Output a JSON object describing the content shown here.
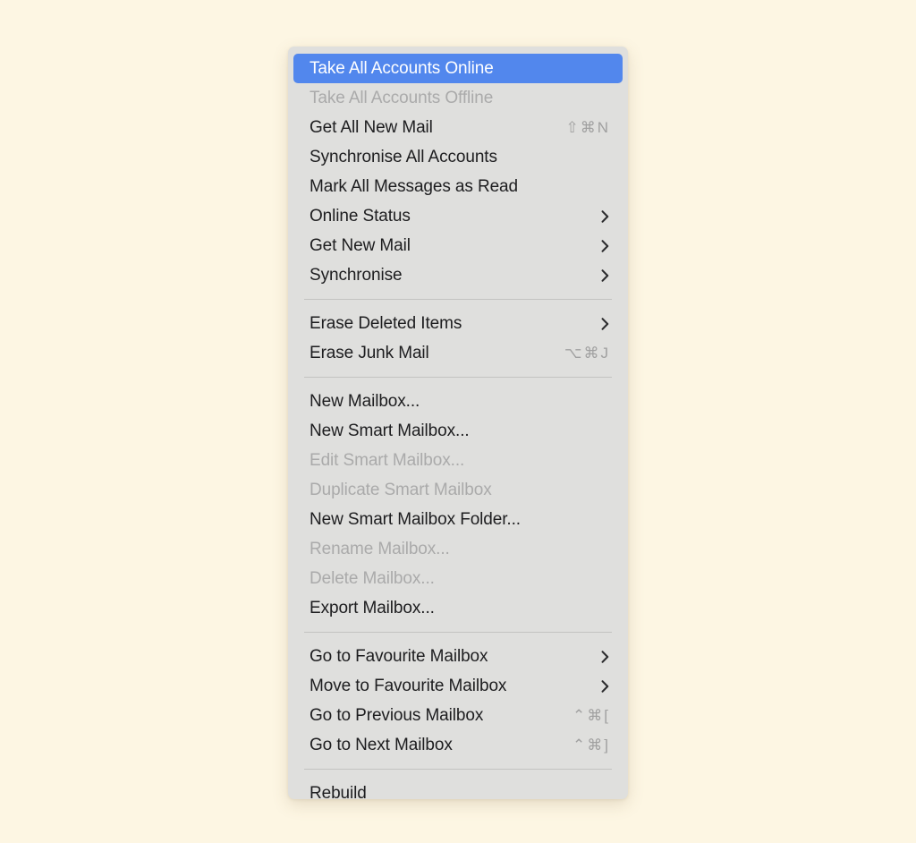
{
  "window": {
    "title": "Mailbox Menu",
    "background_color": "#fdf6e3",
    "panel_color": "#dfdfdd",
    "highlight_color": "#5287ed",
    "text_color": "#1d1d1f",
    "disabled_text_color": "#aaaaaa",
    "separator_color": "#c3c3c1"
  },
  "menu": {
    "groups": [
      {
        "items": [
          {
            "label": "Take All Accounts Online",
            "shortcut": "",
            "submenu": false,
            "disabled": false,
            "selected": true
          },
          {
            "label": "Take All Accounts Offline",
            "shortcut": "",
            "submenu": false,
            "disabled": true,
            "selected": false
          },
          {
            "label": "Get All New Mail",
            "shortcut": "⇧⌘N",
            "submenu": false,
            "disabled": false,
            "selected": false
          },
          {
            "label": "Synchronise All Accounts",
            "shortcut": "",
            "submenu": false,
            "disabled": false,
            "selected": false
          },
          {
            "label": "Mark All Messages as Read",
            "shortcut": "",
            "submenu": false,
            "disabled": false,
            "selected": false
          },
          {
            "label": "Online Status",
            "shortcut": "",
            "submenu": true,
            "disabled": false,
            "selected": false
          },
          {
            "label": "Get New Mail",
            "shortcut": "",
            "submenu": true,
            "disabled": false,
            "selected": false
          },
          {
            "label": "Synchronise",
            "shortcut": "",
            "submenu": true,
            "disabled": false,
            "selected": false
          }
        ]
      },
      {
        "items": [
          {
            "label": "Erase Deleted Items",
            "shortcut": "",
            "submenu": true,
            "disabled": false,
            "selected": false
          },
          {
            "label": "Erase Junk Mail",
            "shortcut": "⌥⌘J",
            "submenu": false,
            "disabled": false,
            "selected": false
          }
        ]
      },
      {
        "items": [
          {
            "label": "New Mailbox...",
            "shortcut": "",
            "submenu": false,
            "disabled": false,
            "selected": false
          },
          {
            "label": "New Smart Mailbox...",
            "shortcut": "",
            "submenu": false,
            "disabled": false,
            "selected": false
          },
          {
            "label": "Edit Smart Mailbox...",
            "shortcut": "",
            "submenu": false,
            "disabled": true,
            "selected": false
          },
          {
            "label": "Duplicate Smart Mailbox",
            "shortcut": "",
            "submenu": false,
            "disabled": true,
            "selected": false
          },
          {
            "label": "New Smart Mailbox Folder...",
            "shortcut": "",
            "submenu": false,
            "disabled": false,
            "selected": false
          },
          {
            "label": "Rename Mailbox...",
            "shortcut": "",
            "submenu": false,
            "disabled": true,
            "selected": false
          },
          {
            "label": "Delete Mailbox...",
            "shortcut": "",
            "submenu": false,
            "disabled": true,
            "selected": false
          },
          {
            "label": "Export Mailbox...",
            "shortcut": "",
            "submenu": false,
            "disabled": false,
            "selected": false
          }
        ]
      },
      {
        "items": [
          {
            "label": "Go to Favourite Mailbox",
            "shortcut": "",
            "submenu": true,
            "disabled": false,
            "selected": false
          },
          {
            "label": "Move to Favourite Mailbox",
            "shortcut": "",
            "submenu": true,
            "disabled": false,
            "selected": false
          },
          {
            "label": "Go to Previous Mailbox",
            "shortcut": "⌃⌘[",
            "submenu": false,
            "disabled": false,
            "selected": false
          },
          {
            "label": "Go to Next Mailbox",
            "shortcut": "⌃⌘]",
            "submenu": false,
            "disabled": false,
            "selected": false
          }
        ]
      },
      {
        "items": [
          {
            "label": "Rebuild",
            "shortcut": "",
            "submenu": false,
            "disabled": false,
            "selected": false
          }
        ]
      }
    ]
  }
}
